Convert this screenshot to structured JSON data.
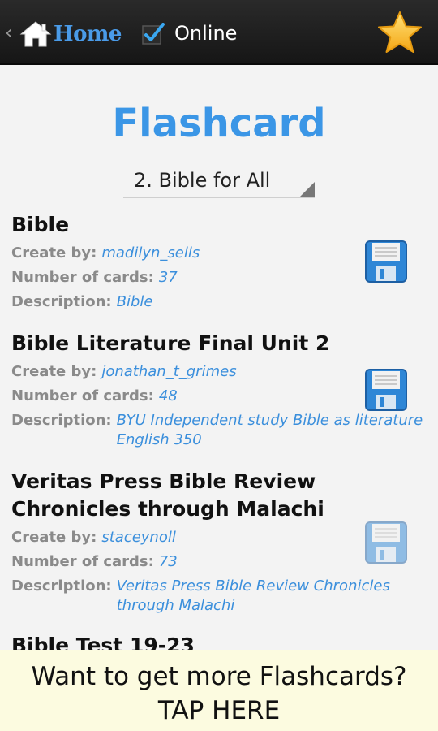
{
  "header": {
    "back_glyph": "‹",
    "home_label": "Home",
    "online_label": "Online",
    "online_checked": true
  },
  "page": {
    "title": "Flashcard",
    "category_selected": "2. Bible for All"
  },
  "labels": {
    "create_by": "Create by:",
    "number_of_cards": "Number of cards:",
    "description": "Description:"
  },
  "decks": [
    {
      "title": "Bible",
      "creator": "madilyn_sells",
      "cards": "37",
      "description": "Bible"
    },
    {
      "title": "Bible Literature Final Unit 2",
      "creator": "jonathan_t_grimes",
      "cards": "48",
      "description": "BYU Independent study Bible as literature English 350"
    },
    {
      "title": "Veritas Press Bible Review Chronicles through Malachi",
      "creator": "staceynoll",
      "cards": "73",
      "description": "Veritas Press Bible Review Chronicles through Malachi"
    },
    {
      "title": "Bible Test 19-23"
    }
  ],
  "banner": {
    "line1": "Want to get more Flashcards?",
    "line2": "TAP HERE"
  },
  "colors": {
    "accent": "#3b96e6",
    "link": "#3b8fdc",
    "topbar": "#1e1e1e",
    "banner_bg": "#fcfbe0"
  },
  "icons": [
    "home-icon",
    "checkbox-icon",
    "star-icon",
    "save-disk-icon"
  ]
}
